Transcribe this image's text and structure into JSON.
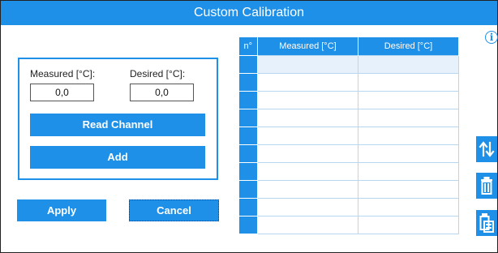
{
  "window": {
    "title": "Custom Calibration"
  },
  "panel": {
    "measured_label": "Measured [°C]:",
    "desired_label": "Desired [°C]:",
    "measured_value": "0,0",
    "desired_value": "0,0",
    "read_channel_label": "Read Channel",
    "add_label": "Add"
  },
  "actions": {
    "apply_label": "Apply",
    "cancel_label": "Cancel"
  },
  "table": {
    "columns": [
      "n°",
      "Measured [°C]",
      "Desired [°C]"
    ],
    "row_count": 10
  },
  "icons": {
    "info": "info-icon",
    "sort": "sort-icon",
    "delete": "trash-icon",
    "clear_all": "clear-list-icon"
  },
  "colors": {
    "accent": "#1e90e8"
  }
}
